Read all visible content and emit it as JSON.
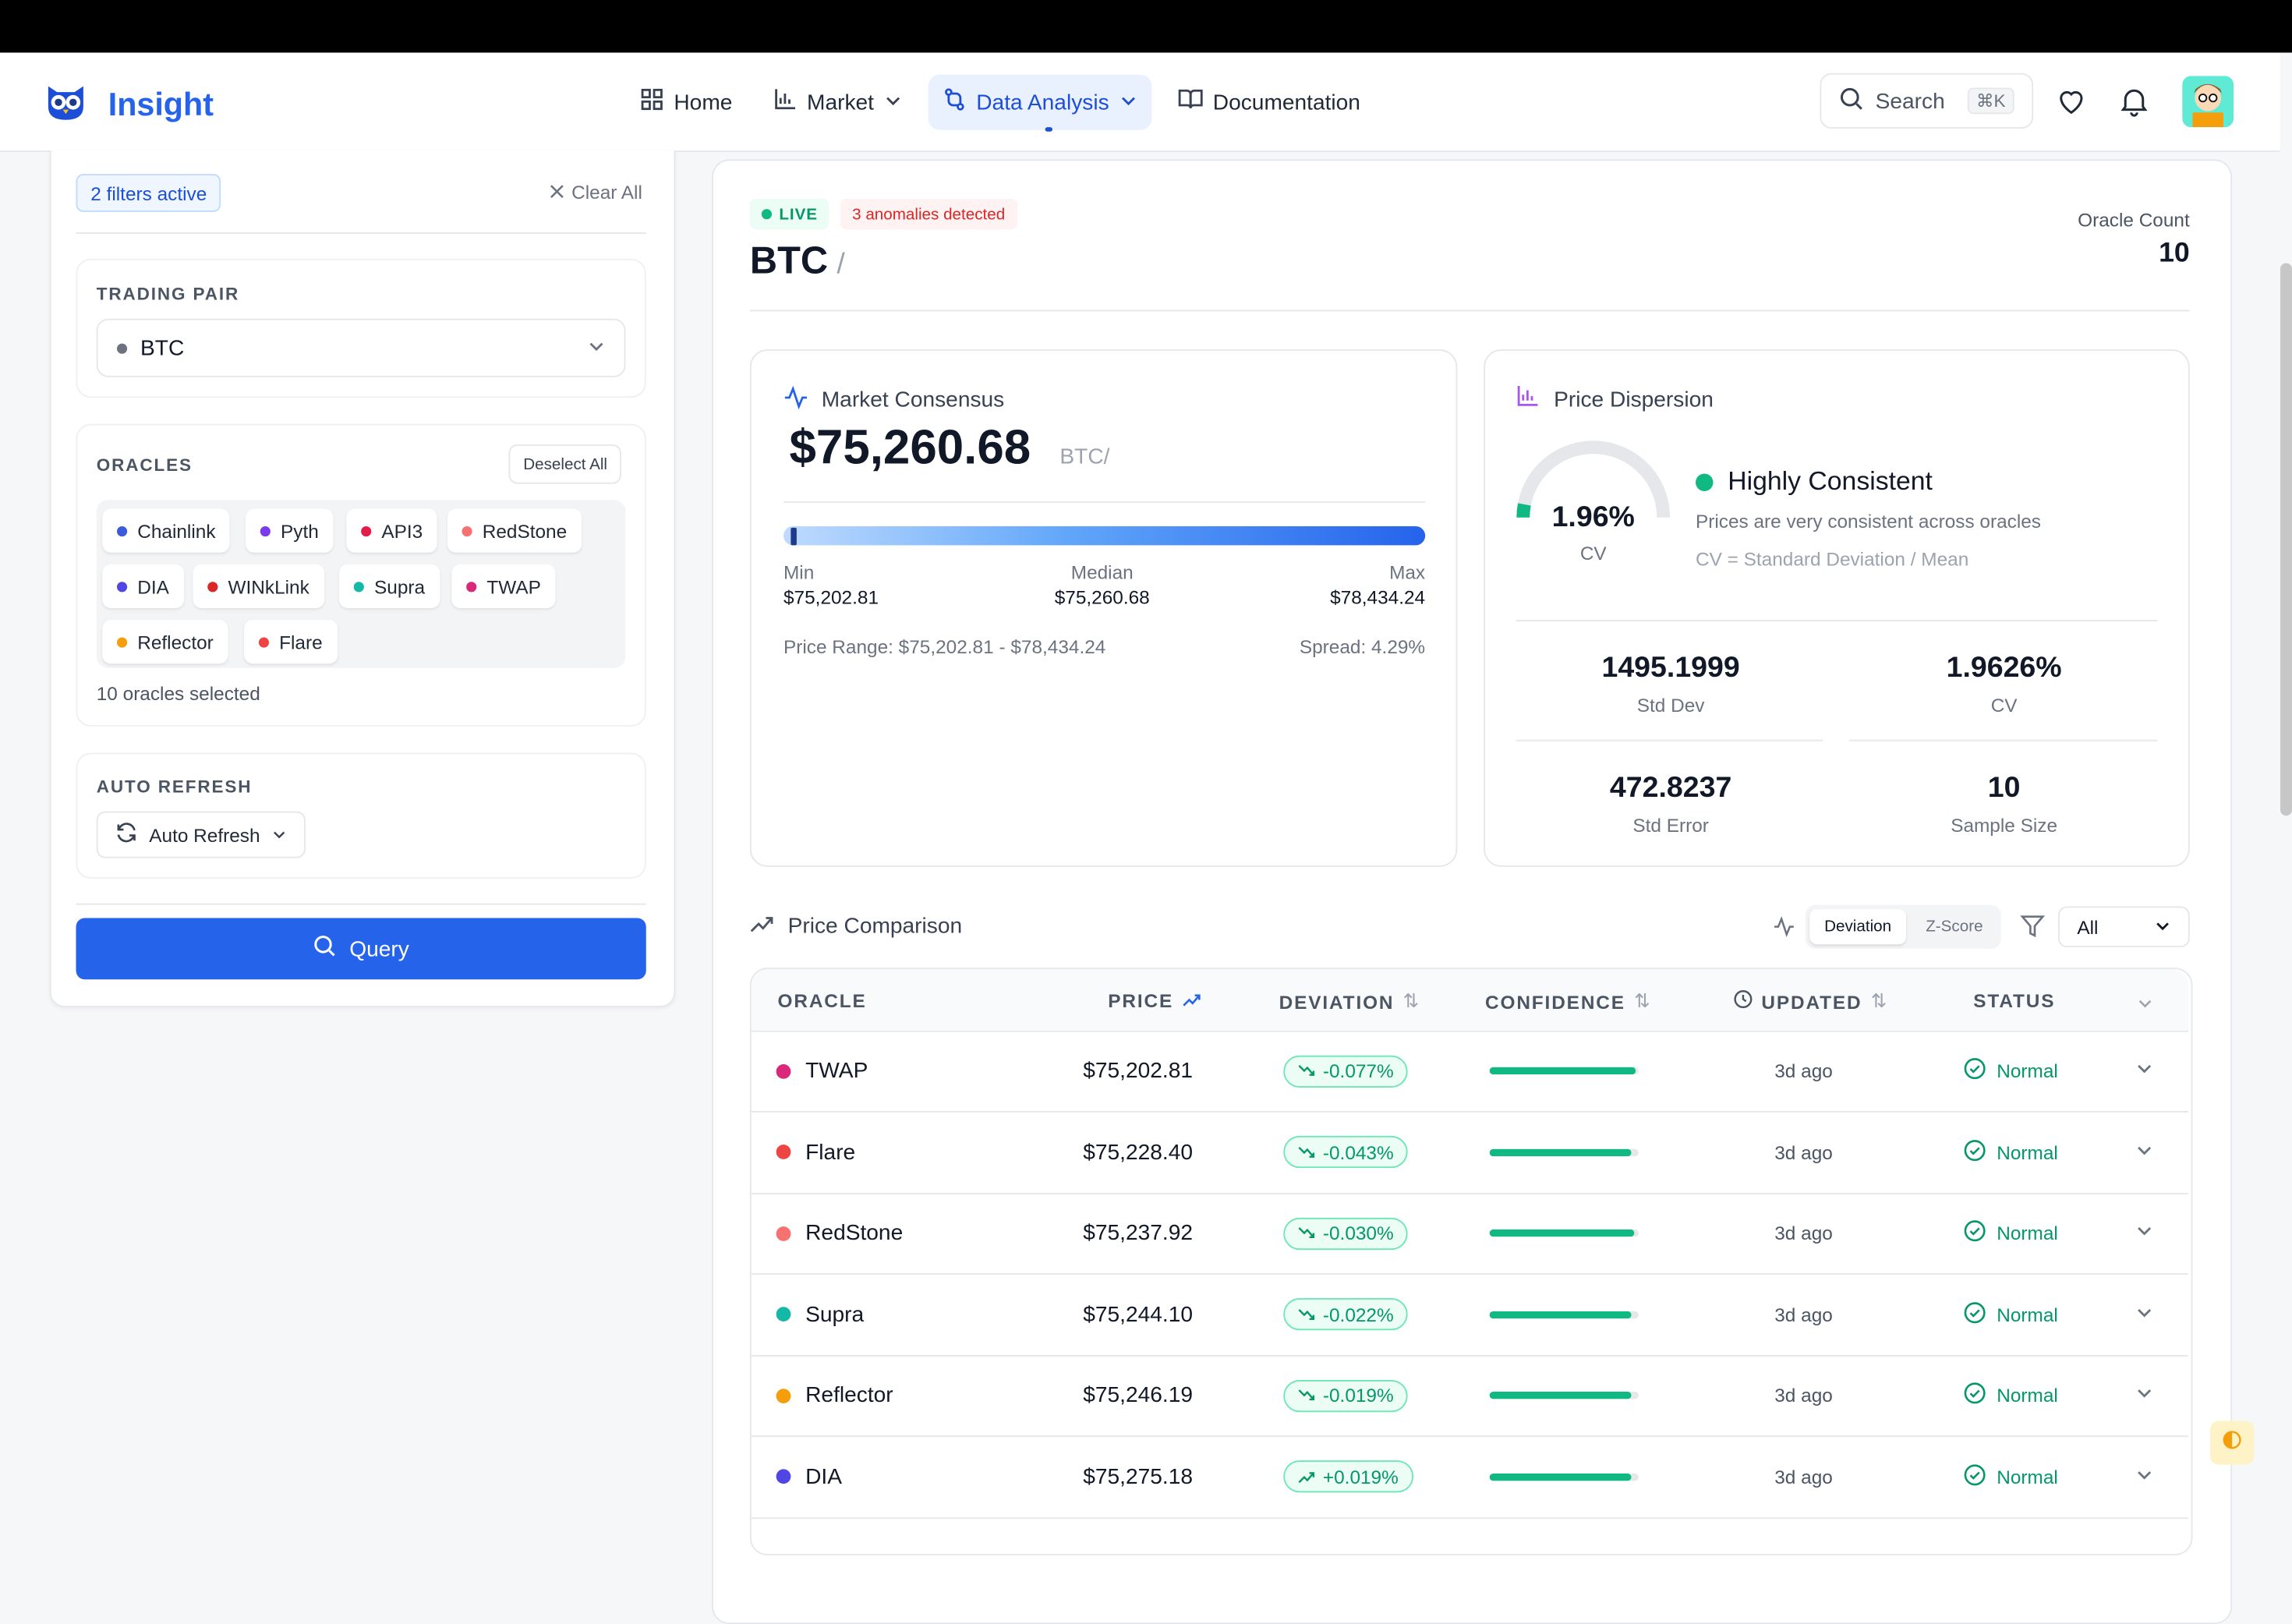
{
  "header": {
    "brand": "Insight",
    "nav": [
      {
        "label": "Home",
        "icon": "grid-icon"
      },
      {
        "label": "Market",
        "icon": "bar-chart-icon"
      },
      {
        "label": "Data Analysis",
        "icon": "flow-icon"
      },
      {
        "label": "Documentation",
        "icon": "book-icon"
      }
    ],
    "search_label": "Search",
    "search_shortcut": "⌘K"
  },
  "sidebar": {
    "filters_badge": "2 filters active",
    "clear_all": "Clear All",
    "trading_pair_label": "TRADING PAIR",
    "trading_pair_value": "BTC",
    "oracles_label": "ORACLES",
    "deselect_all": "Deselect All",
    "oracles": [
      {
        "name": "Chainlink",
        "color": "#3b5bdb"
      },
      {
        "name": "Pyth",
        "color": "#7c3aed"
      },
      {
        "name": "API3",
        "color": "#e11d48"
      },
      {
        "name": "RedStone",
        "color": "#f87171"
      },
      {
        "name": "DIA",
        "color": "#4f46e5"
      },
      {
        "name": "WINkLink",
        "color": "#dc2626"
      },
      {
        "name": "Supra",
        "color": "#14b8a6"
      },
      {
        "name": "TWAP",
        "color": "#db2777"
      },
      {
        "name": "Reflector",
        "color": "#f59e0b"
      },
      {
        "name": "Flare",
        "color": "#ef4444"
      }
    ],
    "oracles_count": "10 oracles selected",
    "auto_refresh_label": "AUTO REFRESH",
    "auto_refresh_button": "Auto Refresh",
    "query_button": "Query"
  },
  "main": {
    "live_badge": "LIVE",
    "anomalies_badge": "3 anomalies detected",
    "pair": "BTC",
    "pair_separator": "/",
    "oracle_count_label": "Oracle Count",
    "oracle_count_value": "10",
    "consensus": {
      "title": "Market Consensus",
      "price": "$75,260.68",
      "unit": "BTC/",
      "min_label": "Min",
      "min_value": "$75,202.81",
      "median_label": "Median",
      "median_value": "$75,260.68",
      "max_label": "Max",
      "max_value": "$78,434.24",
      "price_range": "Price Range: $75,202.81 - $78,434.24",
      "spread": "Spread: 4.29%"
    },
    "dispersion": {
      "title": "Price Dispersion",
      "gauge_value": "1.96%",
      "gauge_fraction": 0.0196,
      "gauge_label": "CV",
      "status_title": "Highly Consistent",
      "status_desc": "Prices are very consistent across oracles",
      "formula": "CV = Standard Deviation / Mean",
      "metrics": [
        {
          "value": "1495.1999",
          "label": "Std Dev"
        },
        {
          "value": "1.9626%",
          "label": "CV"
        },
        {
          "value": "472.8237",
          "label": "Std Error"
        },
        {
          "value": "10",
          "label": "Sample Size"
        }
      ]
    },
    "comparison": {
      "title": "Price Comparison",
      "toggle_deviation": "Deviation",
      "toggle_zscore": "Z-Score",
      "status_filter": "All",
      "columns": [
        "ORACLE",
        "PRICE",
        "DEVIATION",
        "CONFIDENCE",
        "UPDATED",
        "STATUS"
      ],
      "rows": [
        {
          "oracle": "TWAP",
          "color": "#db2777",
          "price": "$75,202.81",
          "deviation": "-0.077%",
          "confidence": 0.98,
          "updated": "3d ago",
          "status": "Normal"
        },
        {
          "oracle": "Flare",
          "color": "#ef4444",
          "price": "$75,228.40",
          "deviation": "-0.043%",
          "confidence": 0.95,
          "updated": "3d ago",
          "status": "Normal"
        },
        {
          "oracle": "RedStone",
          "color": "#f87171",
          "price": "$75,237.92",
          "deviation": "-0.030%",
          "confidence": 0.97,
          "updated": "3d ago",
          "status": "Normal"
        },
        {
          "oracle": "Supra",
          "color": "#14b8a6",
          "price": "$75,244.10",
          "deviation": "-0.022%",
          "confidence": 0.95,
          "updated": "3d ago",
          "status": "Normal"
        },
        {
          "oracle": "Reflector",
          "color": "#f59e0b",
          "price": "$75,246.19",
          "deviation": "-0.019%",
          "confidence": 0.95,
          "updated": "3d ago",
          "status": "Normal"
        },
        {
          "oracle": "DIA",
          "color": "#4f46e5",
          "price": "$75,275.18",
          "deviation": "+0.019%",
          "confidence": 0.95,
          "updated": "3d ago",
          "status": "Normal"
        }
      ]
    }
  }
}
